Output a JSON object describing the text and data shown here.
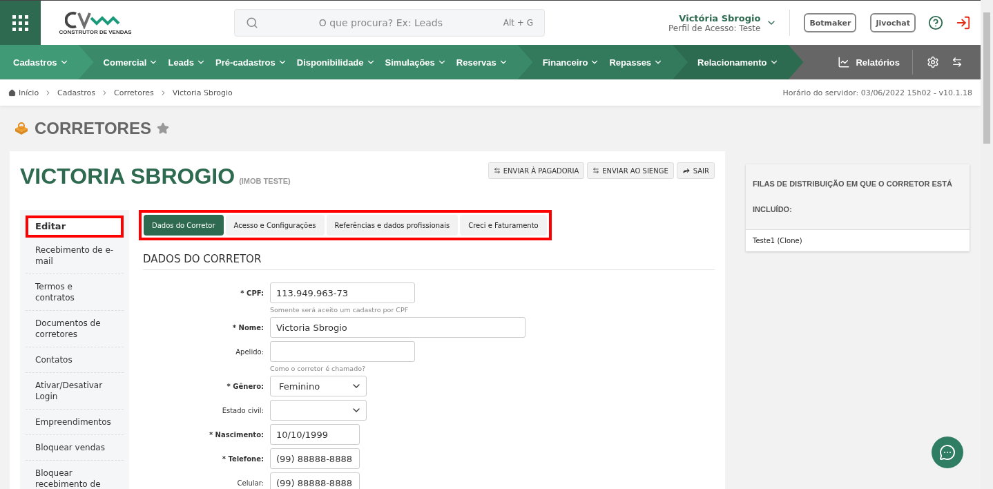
{
  "header": {
    "search": {
      "placeholder": "O que procura? Ex: Leads",
      "shortcut": "Alt + G"
    },
    "logo_caption": "CONSTRUTOR DE VENDAS",
    "user": {
      "name": "Victória Sbrogio",
      "profile": "Perfil de Acesso: Teste"
    },
    "buttons": [
      "Botmaker",
      "Jivochat"
    ]
  },
  "nav": {
    "groups": [
      {
        "items": [
          "Cadastros"
        ]
      },
      {
        "items": [
          "Comercial",
          "Leads",
          "Pré-cadastros",
          "Disponibilidade",
          "Simulações",
          "Reservas"
        ]
      },
      {
        "items": [
          "Financeiro",
          "Repasses"
        ]
      },
      {
        "items": [
          "Relacionamento"
        ]
      }
    ],
    "reports": "Relatórios"
  },
  "breadcrumb": [
    "Início",
    "Cadastros",
    "Corretores",
    "Victoria Sbrogio"
  ],
  "server_time": "Horário do servidor: 03/06/2022 15h02 - v10.1.18",
  "page_title": "CORRETORES",
  "record": {
    "name": "VICTORIA SBROGIO",
    "company": "(IMOB TESTE)"
  },
  "actions": [
    {
      "label": "ENVIAR À PAGADORIA",
      "kind": "transfer"
    },
    {
      "label": "ENVIAR AO SIENGE",
      "kind": "transfer"
    },
    {
      "label": "SAIR",
      "kind": "exit"
    }
  ],
  "side_menu": [
    {
      "label": "Editar",
      "selected": true
    },
    {
      "label": "Recebimento de e-mail",
      "selected": false
    },
    {
      "label": "Termos e contratos",
      "selected": false
    },
    {
      "label": "Documentos de corretores",
      "selected": false
    },
    {
      "label": "Contatos",
      "selected": false
    },
    {
      "label": "Ativar/Desativar Login",
      "selected": false
    },
    {
      "label": "Empreendimentos",
      "selected": false
    },
    {
      "label": "Bloquear vendas",
      "selected": false
    },
    {
      "label": "Bloquear recebimento de",
      "selected": false
    }
  ],
  "tabs": [
    {
      "label": "Dados do Corretor",
      "selected": true
    },
    {
      "label": "Acesso e Configurações",
      "selected": false
    },
    {
      "label": "Referências e dados profissionais",
      "selected": false
    },
    {
      "label": "Creci e Faturamento",
      "selected": false
    }
  ],
  "section_title": "DADOS DO CORRETOR",
  "fields": [
    {
      "label": "* CPF:",
      "required": true,
      "kind": "text",
      "value": "113.949.963-73",
      "hint": "Somente será aceito um cadastro por CPF"
    },
    {
      "label": "* Nome:",
      "required": true,
      "kind": "text",
      "value": "Victoria Sbrogio"
    },
    {
      "label": "Apelido:",
      "required": false,
      "kind": "text",
      "hint": "Como o corretor é chamado?"
    },
    {
      "label": "* Gênero:",
      "required": true,
      "kind": "select",
      "value": "Feminino"
    },
    {
      "label": "Estado civil:",
      "required": false,
      "kind": "select"
    },
    {
      "label": "* Nascimento:",
      "required": true,
      "kind": "text",
      "value": "10/10/1999"
    },
    {
      "label": "* Telefone:",
      "required": true,
      "kind": "text",
      "value": "(99) 88888-8888"
    },
    {
      "label": "Celular:",
      "required": false,
      "kind": "text",
      "value": "(99) 88888-8888"
    }
  ],
  "queues": {
    "title": "FILAS DE DISTRIBUIÇÃO EM QUE O CORRETOR ESTÁ INCLUÍDO:",
    "items": [
      "Teste1 (Clone)"
    ]
  }
}
